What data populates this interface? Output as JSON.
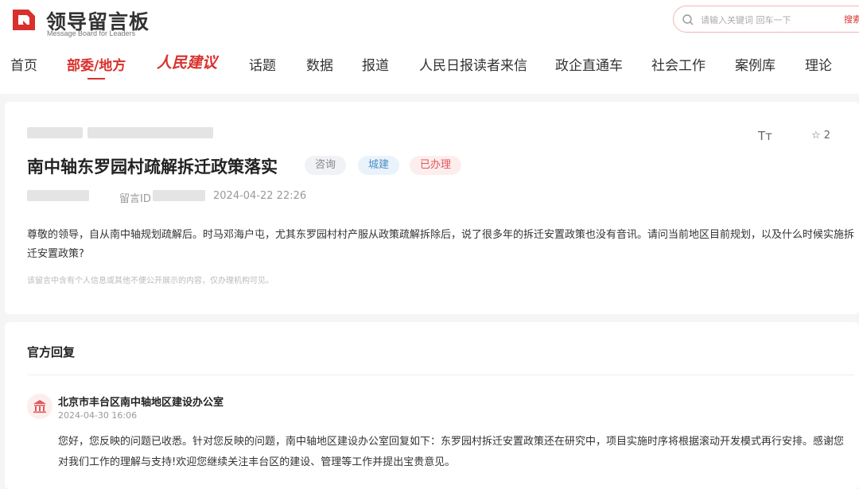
{
  "header": {
    "logo_title": "领导留言板",
    "logo_sub": "Message Board for Leaders",
    "search_placeholder": "请输入关键词 回车一下",
    "search_button": "搜索"
  },
  "nav": {
    "items": [
      "首页",
      "部委/地方",
      "人民建议",
      "话题",
      "数据",
      "报道",
      "人民日报读者来信",
      "政企直通车",
      "社会工作",
      "案例库",
      "理论"
    ],
    "active": "部委/地方"
  },
  "message": {
    "title": "南中轴东罗园村疏解拆迁政策落实",
    "tags": [
      "咨询",
      "城建",
      "已办理"
    ],
    "id_label": "留言ID",
    "datetime": "2024-04-22 22:26",
    "font_toggle": "Tт",
    "star_count": "2",
    "body": "尊敬的领导，自从南中轴规划疏解后。时马邓海户屯，尤其东罗园村村产服从政策疏解拆除后，说了很多年的拆迁安置政策也没有音讯。请问当前地区目前规划，以及什么时候实施拆迁安置政策?",
    "privacy_note": "该留言中含有个人信息或其他不便公开展示的内容，仅办理机构可见。"
  },
  "reply": {
    "section_title": "官方回复",
    "org_name": "北京市丰台区南中轴地区建设办公室",
    "datetime": "2024-04-30 16:06",
    "body": "您好，您反映的问题已收悉。针对您反映的问题，南中轴地区建设办公室回复如下：东罗园村拆迁安置政策还在研究中，项目实施时序将根据滚动开发模式再行安排。感谢您对我们工作的理解与支持!欢迎您继续关注丰台区的建设、管理等工作并提出宝贵意见。"
  },
  "colors": {
    "brand": "#d9302c",
    "tag_city": "#4a8fc4",
    "tag_done": "#e0575a"
  }
}
